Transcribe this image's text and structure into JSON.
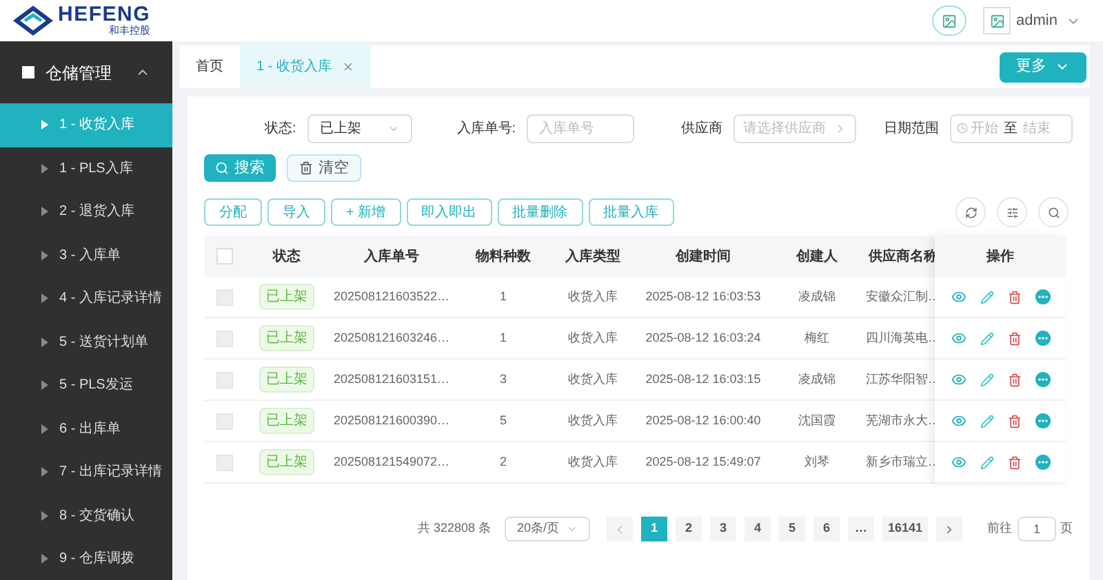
{
  "header": {
    "logo_text": "HEFENG",
    "logo_subtitle": "和丰控股",
    "user": "admin"
  },
  "sidebar": {
    "group": {
      "label": "仓储管理",
      "expanded": true
    },
    "items": [
      {
        "label": "1 - 收货入库",
        "selected": true
      },
      {
        "label": "1 - PLS入库",
        "selected": false
      },
      {
        "label": "2 - 退货入库",
        "selected": false
      },
      {
        "label": "3 - 入库单",
        "selected": false
      },
      {
        "label": "4 - 入库记录详情",
        "selected": false
      },
      {
        "label": "5 - 送货计划单",
        "selected": false
      },
      {
        "label": "5 - PLS发运",
        "selected": false
      },
      {
        "label": "6 - 出库单",
        "selected": false
      },
      {
        "label": "7 - 出库记录详情",
        "selected": false
      },
      {
        "label": "8 - 交货确认",
        "selected": false
      },
      {
        "label": "9 - 仓库调拨",
        "selected": false
      }
    ]
  },
  "tabs": [
    {
      "label": "首页",
      "selected": false,
      "closable": false
    },
    {
      "label": "1 - 收货入库",
      "selected": true,
      "closable": true
    }
  ],
  "more_button": "更多",
  "filters": {
    "status": {
      "label": "状态:",
      "value": "已上架"
    },
    "order_no": {
      "label": "入库单号:",
      "placeholder": "入库单号"
    },
    "supplier": {
      "label": "供应商",
      "placeholder": "请选择供应商"
    },
    "date_range": {
      "label": "日期范围",
      "start_placeholder": "开始",
      "separator": "至",
      "end_placeholder": "结束"
    }
  },
  "search_button": "搜索",
  "clear_button": "清空",
  "actions": [
    "分配",
    "导入",
    "+ 新增",
    "即入即出",
    "批量删除",
    "批量入库"
  ],
  "table": {
    "header_checked": false,
    "columns": [
      "状态",
      "入库单号",
      "物料种数",
      "入库类型",
      "创建时间",
      "创建人",
      "供应商名称",
      "操作"
    ],
    "rows": [
      {
        "disabled": true,
        "status": "已上架",
        "order_no": "202508121603522…",
        "count": "1",
        "type": "收货入库",
        "created": "2025-08-12 16:03:53",
        "creator": "凌成锦",
        "supplier": "安徽众汇制…"
      },
      {
        "disabled": true,
        "status": "已上架",
        "order_no": "202508121603246…",
        "count": "1",
        "type": "收货入库",
        "created": "2025-08-12 16:03:24",
        "creator": "梅红",
        "supplier": "四川海英电…"
      },
      {
        "disabled": true,
        "status": "已上架",
        "order_no": "202508121603151…",
        "count": "3",
        "type": "收货入库",
        "created": "2025-08-12 16:03:15",
        "creator": "凌成锦",
        "supplier": "江苏华阳智…"
      },
      {
        "disabled": true,
        "status": "已上架",
        "order_no": "202508121600390…",
        "count": "5",
        "type": "收货入库",
        "created": "2025-08-12 16:00:40",
        "creator": "沈国霞",
        "supplier": "芜湖市永大…"
      },
      {
        "disabled": true,
        "status": "已上架",
        "order_no": "202508121549072…",
        "count": "2",
        "type": "收货入库",
        "created": "2025-08-12 15:49:07",
        "creator": "刘琴",
        "supplier": "新乡市瑞立…"
      }
    ]
  },
  "pagination": {
    "total": "共 322808 条",
    "page_size": "20条/页",
    "pages": [
      {
        "label": "1",
        "selected": true
      },
      {
        "label": "2",
        "selected": false
      },
      {
        "label": "3",
        "selected": false
      },
      {
        "label": "4",
        "selected": false
      },
      {
        "label": "5",
        "selected": false
      },
      {
        "label": "6",
        "selected": false
      },
      {
        "label": "…",
        "selected": false
      },
      {
        "label": "16141",
        "selected": false
      }
    ],
    "goto_label": "前往",
    "goto_value": "1",
    "goto_suffix": "页"
  }
}
